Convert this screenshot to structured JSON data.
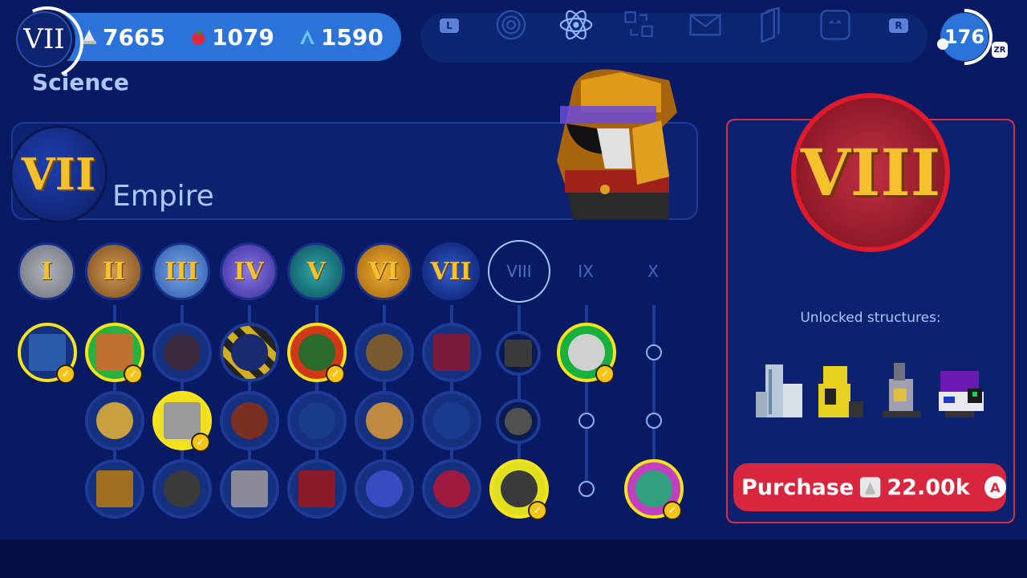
{
  "header": {
    "era_numeral": "VII",
    "resources": [
      {
        "icon": "concrete-icon",
        "value": "7665"
      },
      {
        "icon": "apple-food-icon",
        "value": "1079"
      },
      {
        "icon": "crystal-icon",
        "value": "1590"
      }
    ],
    "tabs": [
      {
        "name": "l-shoulder",
        "label": "L"
      },
      {
        "name": "planet-icon"
      },
      {
        "name": "atom-icon",
        "active": true
      },
      {
        "name": "cubes-trade-icon"
      },
      {
        "name": "mail-icon"
      },
      {
        "name": "cards-icon"
      },
      {
        "name": "face-icon"
      },
      {
        "name": "r-shoulder",
        "label": "R"
      }
    ],
    "level": "176",
    "zr_label": "ZR"
  },
  "section_title": "Science",
  "current_era": {
    "numeral": "VII",
    "name": "Empire"
  },
  "eras": [
    {
      "label": "I",
      "color": "#9aa0a8"
    },
    {
      "label": "II",
      "color": "#b07a40"
    },
    {
      "label": "III",
      "color": "#5a8ad0"
    },
    {
      "label": "IV",
      "color": "#6a5ad0"
    },
    {
      "label": "V",
      "color": "#1f8a8a"
    },
    {
      "label": "VI",
      "color": "#d09020"
    },
    {
      "label": "VII",
      "color": "#2050c0"
    },
    {
      "label": "VIII",
      "state": "locked"
    },
    {
      "label": "IX",
      "state": "future"
    },
    {
      "label": "X",
      "state": "future"
    }
  ],
  "panel": {
    "numeral": "VIII",
    "unlocked_label": "Unlocked structures:",
    "purchase_label": "Purchase",
    "purchase_cost": "22.00k",
    "button_hint": "A"
  },
  "colors": {
    "accent": "#2b73d9",
    "completed": "#f7e319",
    "purchase": "#d7263d"
  }
}
